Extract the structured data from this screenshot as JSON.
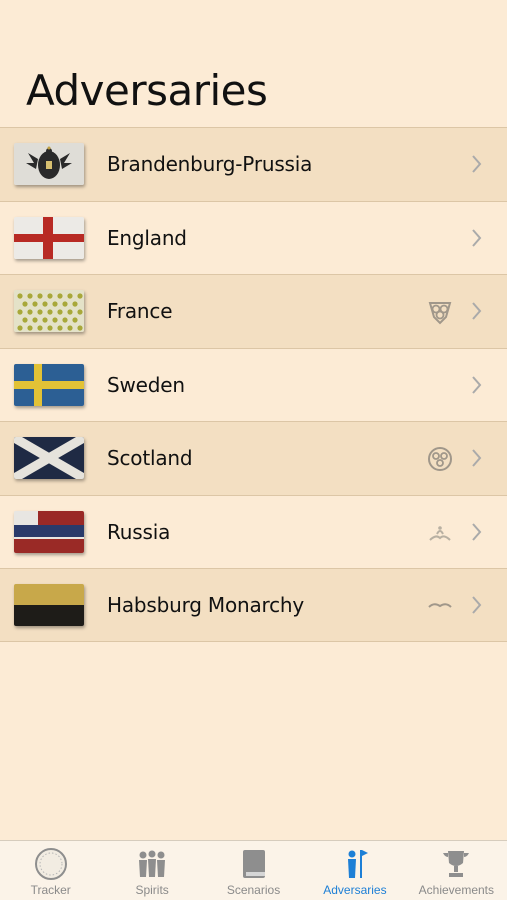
{
  "page": {
    "title": "Adversaries"
  },
  "adversaries": [
    {
      "name": "Brandenburg-Prussia",
      "flag": "prussia-flag-icon",
      "badge": null
    },
    {
      "name": "England",
      "flag": "england-flag-icon",
      "badge": null
    },
    {
      "name": "France",
      "flag": "france-flag-icon",
      "badge": "triskele-badge-icon"
    },
    {
      "name": "Sweden",
      "flag": "sweden-flag-icon",
      "badge": null
    },
    {
      "name": "Scotland",
      "flag": "scotland-flag-icon",
      "badge": "spiral-badge-icon"
    },
    {
      "name": "Russia",
      "flag": "russia-flag-icon",
      "badge": "wave-badge-icon"
    },
    {
      "name": "Habsburg Monarchy",
      "flag": "habsburg-flag-icon",
      "badge": "wing-badge-icon"
    }
  ],
  "tabbar": {
    "tabs": [
      {
        "label": "Tracker",
        "icon": "tracker-dial-icon",
        "active": false
      },
      {
        "label": "Spirits",
        "icon": "spirits-icon",
        "active": false
      },
      {
        "label": "Scenarios",
        "icon": "book-icon",
        "active": false
      },
      {
        "label": "Adversaries",
        "icon": "soldier-flag-icon",
        "active": true
      },
      {
        "label": "Achievements",
        "icon": "trophy-icon",
        "active": false
      }
    ]
  },
  "colors": {
    "background": "#fcebd5",
    "row_alt": "#f3dfc2",
    "accent": "#1d7fd6",
    "inactive_tab": "#8a8a8a"
  }
}
